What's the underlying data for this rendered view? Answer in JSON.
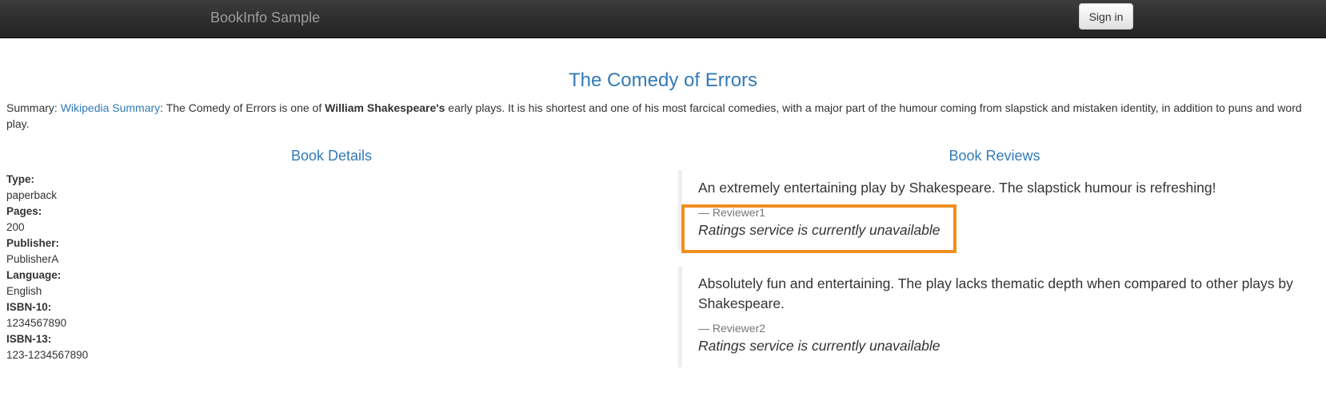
{
  "navbar": {
    "brand": "BookInfo Sample",
    "signin_label": "Sign in"
  },
  "book": {
    "title": "The Comedy of Errors",
    "summary_prefix": "Summary: ",
    "summary_link": "Wikipedia Summary",
    "summary_mid": ": The Comedy of Errors is one of ",
    "summary_author": "William Shakespeare's",
    "summary_rest": " early plays. It is his shortest and one of his most farcical comedies, with a major part of the humour coming from slapstick and mistaken identity, in addition to puns and word play."
  },
  "details": {
    "heading": "Book Details",
    "fields": [
      {
        "label": "Type:",
        "value": "paperback"
      },
      {
        "label": "Pages:",
        "value": "200"
      },
      {
        "label": "Publisher:",
        "value": "PublisherA"
      },
      {
        "label": "Language:",
        "value": "English"
      },
      {
        "label": "ISBN-10:",
        "value": "1234567890"
      },
      {
        "label": "ISBN-13:",
        "value": "123-1234567890"
      }
    ]
  },
  "reviews": {
    "heading": "Book Reviews",
    "items": [
      {
        "text": "An extremely entertaining play by Shakespeare. The slapstick humour is refreshing!",
        "author": "— Reviewer1",
        "rating": "Ratings service is currently unavailable"
      },
      {
        "text": "Absolutely fun and entertaining. The play lacks thematic depth when compared to other plays by Shakespeare.",
        "author": "— Reviewer2",
        "rating": "Ratings service is currently unavailable"
      }
    ]
  },
  "colors": {
    "accent": "#337ab7",
    "highlight": "#ef8f20",
    "navbar": "#222222"
  }
}
